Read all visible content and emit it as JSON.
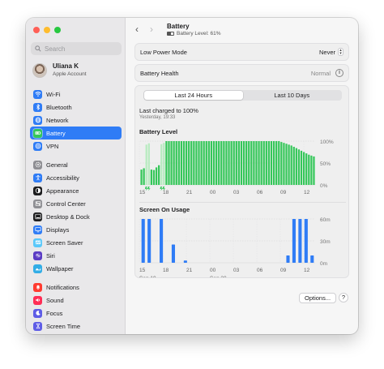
{
  "sidebar": {
    "search_placeholder": "Search",
    "account": {
      "name": "Uliana K",
      "subtitle": "Apple Account"
    },
    "groups": [
      [
        {
          "id": "wifi",
          "label": "Wi-Fi",
          "icon": "wifi-icon",
          "color": "#2f7cf6"
        },
        {
          "id": "bluetooth",
          "label": "Bluetooth",
          "icon": "bluetooth-icon",
          "color": "#2f7cf6"
        },
        {
          "id": "network",
          "label": "Network",
          "icon": "globe-icon",
          "color": "#2f7cf6"
        },
        {
          "id": "battery",
          "label": "Battery",
          "icon": "battery-icon",
          "color": "#34c759",
          "active": true
        },
        {
          "id": "vpn",
          "label": "VPN",
          "icon": "vpn-globe-icon",
          "color": "#2f7cf6"
        }
      ],
      [
        {
          "id": "general",
          "label": "General",
          "icon": "gear-icon",
          "color": "#8e8e93"
        },
        {
          "id": "accessibility",
          "label": "Accessibility",
          "icon": "accessibility-icon",
          "color": "#2f7cf6"
        },
        {
          "id": "appearance",
          "label": "Appearance",
          "icon": "appearance-icon",
          "color": "#1d1d1f"
        },
        {
          "id": "control-center",
          "label": "Control Center",
          "icon": "control-center-icon",
          "color": "#8e8e93"
        },
        {
          "id": "desktop-dock",
          "label": "Desktop & Dock",
          "icon": "dock-icon",
          "color": "#1d1d1f"
        },
        {
          "id": "displays",
          "label": "Displays",
          "icon": "display-icon",
          "color": "#2f7cf6"
        },
        {
          "id": "screen-saver",
          "label": "Screen Saver",
          "icon": "screen-saver-icon",
          "color": "#5ac8fa"
        },
        {
          "id": "siri",
          "label": "Siri",
          "icon": "siri-icon",
          "color": "#5b3cc4"
        },
        {
          "id": "wallpaper",
          "label": "Wallpaper",
          "icon": "wallpaper-icon",
          "color": "#32ade6"
        }
      ],
      [
        {
          "id": "notifications",
          "label": "Notifications",
          "icon": "bell-icon",
          "color": "#ff3b30"
        },
        {
          "id": "sound",
          "label": "Sound",
          "icon": "speaker-icon",
          "color": "#ff2d55"
        },
        {
          "id": "focus",
          "label": "Focus",
          "icon": "moon-icon",
          "color": "#5e5ce6"
        },
        {
          "id": "screen-time",
          "label": "Screen Time",
          "icon": "hourglass-icon",
          "color": "#5e5ce6"
        }
      ]
    ]
  },
  "header": {
    "title": "Battery",
    "subtitle": "Battery Level: 61%",
    "back_glyph": "‹",
    "forward_glyph": "›"
  },
  "settings": {
    "low_power_label": "Low Power Mode",
    "low_power_value": "Never",
    "battery_health_label": "Battery Health",
    "battery_health_value": "Normal"
  },
  "usage": {
    "tabs": [
      {
        "label": "Last 24 Hours",
        "selected": true
      },
      {
        "label": "Last 10 Days",
        "selected": false
      }
    ],
    "last_charged": "Last charged to 100%",
    "last_charged_time": "Yesterday, 19:33",
    "battery_level_title": "Battery Level",
    "screen_on_title": "Screen On Usage"
  },
  "chart_data": [
    {
      "type": "bar",
      "title": "Battery Level",
      "x_tick_labels": [
        "15",
        "18",
        "21",
        "00",
        "03",
        "06",
        "09",
        "12"
      ],
      "y_tick_labels": [
        "100%",
        "50%",
        "0%"
      ],
      "ylim": [
        0,
        100
      ],
      "y_unit": "%",
      "bar_color": "#34c759",
      "charging_color": "#b7ebc0",
      "charging_bars": [
        2,
        3,
        8,
        9
      ],
      "values": [
        35,
        38,
        92,
        95,
        35,
        34,
        40,
        45,
        93,
        96,
        100,
        100,
        100,
        100,
        100,
        100,
        100,
        100,
        100,
        100,
        100,
        100,
        100,
        100,
        100,
        100,
        100,
        100,
        100,
        100,
        100,
        100,
        100,
        100,
        100,
        100,
        100,
        100,
        100,
        100,
        100,
        100,
        100,
        100,
        100,
        100,
        100,
        100,
        100,
        100,
        100,
        100,
        100,
        100,
        100,
        100,
        98,
        96,
        94,
        92,
        90,
        87,
        84,
        81,
        78,
        75,
        72,
        69,
        67,
        65
      ]
    },
    {
      "type": "bar",
      "title": "Screen On Usage",
      "x_tick_labels": [
        "15",
        "18",
        "21",
        "00",
        "03",
        "06",
        "09",
        "12"
      ],
      "y_tick_labels": [
        "60m",
        "30m",
        "0m"
      ],
      "ylim": [
        0,
        60
      ],
      "y_unit": "minutes",
      "bar_color": "#2f7cf6",
      "date_labels": [
        "Sep 19",
        "Sep 20"
      ],
      "values": [
        60,
        60,
        0,
        60,
        0,
        25,
        0,
        3,
        0,
        0,
        0,
        0,
        0,
        0,
        0,
        0,
        0,
        0,
        0,
        0,
        0,
        0,
        0,
        0,
        10,
        60,
        60,
        60,
        10
      ]
    }
  ],
  "footer": {
    "options_label": "Options...",
    "help_label": "?"
  }
}
